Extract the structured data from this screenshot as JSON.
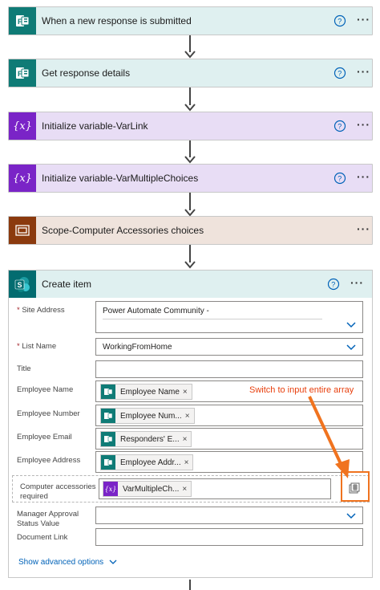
{
  "flow": {
    "steps": [
      {
        "title": "When a new response is submitted",
        "icon": "forms-icon"
      },
      {
        "title": "Get response details",
        "icon": "forms-icon"
      },
      {
        "title": "Initialize variable-VarLink",
        "icon": "variable-icon"
      },
      {
        "title": "Initialize variable-VarMultipleChoices",
        "icon": "variable-icon"
      },
      {
        "title": "Scope-Computer Accessories choices",
        "icon": "scope-icon"
      }
    ],
    "more_label": "···"
  },
  "create_item": {
    "title": "Create item",
    "icon": "sharepoint-icon",
    "fields": {
      "site_address": {
        "label": "Site Address",
        "required": "*",
        "value": "Power Automate Community -"
      },
      "list_name": {
        "label": "List Name",
        "required": "*",
        "value": "WorkingFromHome"
      },
      "title": {
        "label": "Title",
        "value": ""
      },
      "employee_name": {
        "label": "Employee Name",
        "token": "Employee Name"
      },
      "employee_number": {
        "label": "Employee Number",
        "token": "Employee Num..."
      },
      "employee_email": {
        "label": "Employee Email",
        "token": "Responders' E..."
      },
      "employee_address": {
        "label": "Employee Address",
        "token": "Employee Addr..."
      },
      "computer_accessories": {
        "label_line1": "Computer accessories",
        "label_line2": "required",
        "token": "VarMultipleCh..."
      },
      "manager_approval": {
        "label_line1": "Manager Approval",
        "label_line2": "Status Value",
        "value": ""
      },
      "document_link": {
        "label": "Document Link",
        "value": ""
      }
    },
    "token_remove": "×",
    "show_advanced": "Show advanced options"
  },
  "annotation": {
    "text": "Switch to input entire array"
  },
  "colors": {
    "forms": "#0f7b76",
    "variable": "#7a24c7",
    "scope": "#8b3a0e",
    "sharepoint": "#036c70",
    "annotation": "#e8400e"
  }
}
